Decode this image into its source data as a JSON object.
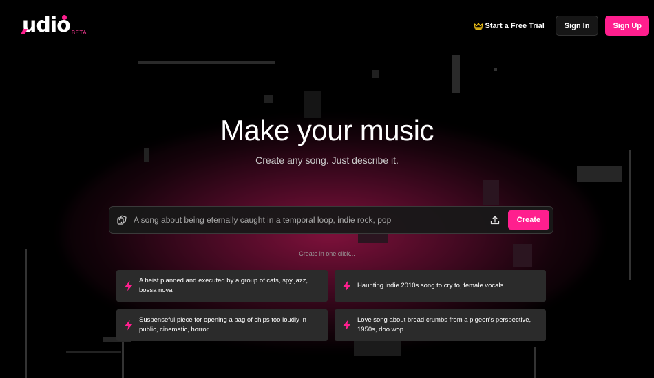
{
  "brand": {
    "name": "udio",
    "badge": "BETA"
  },
  "header": {
    "trial_label": "Start a Free Trial",
    "signin_label": "Sign In",
    "signup_label": "Sign Up"
  },
  "hero": {
    "title": "Make your music",
    "subtitle": "Create any song. Just describe it."
  },
  "prompt": {
    "placeholder": "A song about being eternally caught in a temporal loop, indie rock, pop",
    "create_label": "Create"
  },
  "one_click_label": "Create in one click...",
  "suggestions": [
    {
      "text": "A heist planned and executed by a group of cats, spy jazz, bossa nova"
    },
    {
      "text": "Haunting indie 2010s song to cry to, female vocals"
    },
    {
      "text": "Suspenseful piece for opening a bag of chips too loudly in public, cinematic, horror"
    },
    {
      "text": "Love song about bread crumbs from a pigeon's perspective, 1950s, doo wop"
    }
  ],
  "colors": {
    "accent": "#ff1f8e",
    "background": "#000000",
    "card": "#2b2b2b"
  },
  "icons": [
    "crown-icon",
    "dice-icon",
    "upload-icon",
    "bolt-icon"
  ]
}
